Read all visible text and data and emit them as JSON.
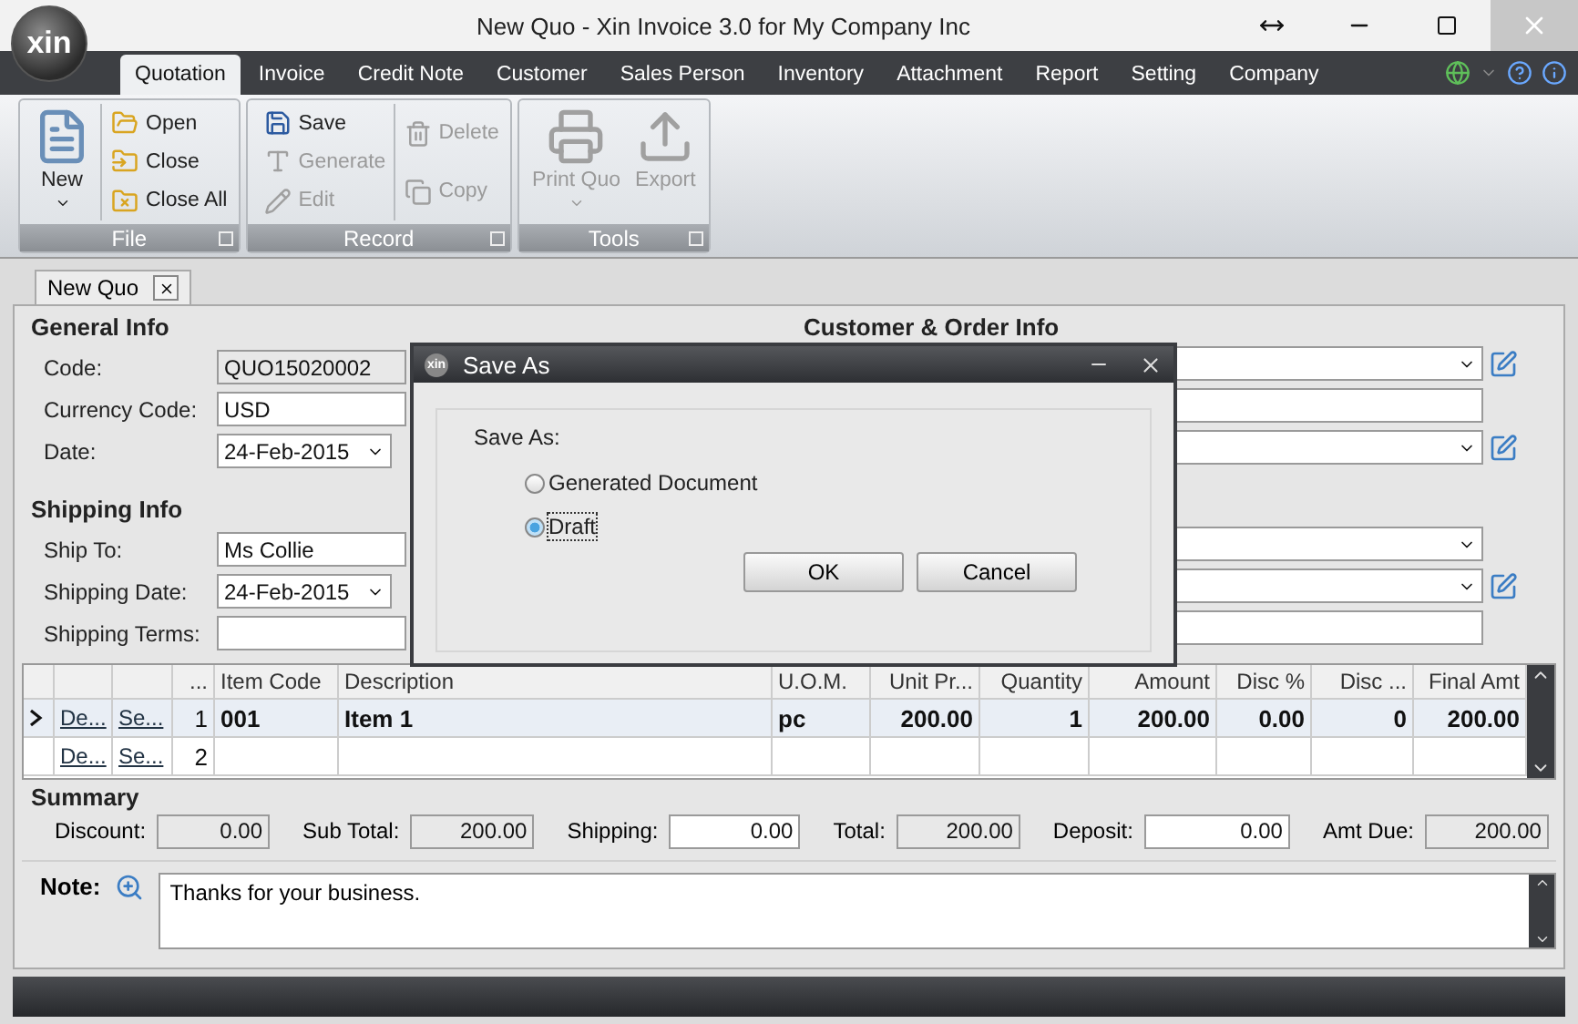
{
  "window": {
    "logo": "xin",
    "title": "New Quo - Xin Invoice 3.0 for My Company Inc"
  },
  "ribbon_tabs": [
    {
      "label": "Quotation",
      "selected": true
    },
    {
      "label": "Invoice",
      "selected": false
    },
    {
      "label": "Credit Note",
      "selected": false
    },
    {
      "label": "Customer",
      "selected": false
    },
    {
      "label": "Sales Person",
      "selected": false
    },
    {
      "label": "Inventory",
      "selected": false
    },
    {
      "label": "Attachment",
      "selected": false
    },
    {
      "label": "Report",
      "selected": false
    },
    {
      "label": "Setting",
      "selected": false
    },
    {
      "label": "Company",
      "selected": false
    }
  ],
  "ribbon_groups": [
    {
      "label": "File",
      "large": [
        {
          "label": "New",
          "disabled": false,
          "dropdown": true
        }
      ],
      "columns": [
        [
          {
            "label": "Open",
            "disabled": false
          },
          {
            "label": "Close",
            "disabled": false
          },
          {
            "label": "Close All",
            "disabled": false
          }
        ]
      ]
    },
    {
      "label": "Record",
      "columns": [
        [
          {
            "label": "Save",
            "disabled": false
          },
          {
            "label": "Generate",
            "disabled": true
          },
          {
            "label": "Edit",
            "disabled": true
          }
        ],
        [
          {
            "label": "Delete",
            "disabled": true
          },
          {
            "label": "Copy",
            "disabled": true
          }
        ]
      ]
    },
    {
      "label": "Tools",
      "large": [
        {
          "label": "Print Quo",
          "disabled": true,
          "dropdown": true
        },
        {
          "label": "Export",
          "disabled": true,
          "dropdown": false
        }
      ]
    }
  ],
  "document_tabs": [
    {
      "label": "New Quo",
      "selected": true
    }
  ],
  "general_info": {
    "title": "General Info",
    "fields": [
      {
        "label": "Code:",
        "value": "QUO15020002",
        "kind": "readonly"
      },
      {
        "label": "Currency Code:",
        "value": "USD",
        "kind": "text"
      },
      {
        "label": "Date:",
        "value": "24-Feb-2015",
        "kind": "date"
      }
    ]
  },
  "shipping_info": {
    "title": "Shipping Info",
    "fields": [
      {
        "label": "Ship To:",
        "value": "Ms Collie",
        "kind": "text"
      },
      {
        "label": "Shipping Date:",
        "value": "24-Feb-2015",
        "kind": "date"
      },
      {
        "label": "Shipping Terms:",
        "kind": "text"
      }
    ]
  },
  "customer_order_info": {
    "title": "Customer & Order Info",
    "fields": [
      {
        "kind": "combo",
        "editable": true
      },
      {
        "kind": "text",
        "editable": false
      },
      {
        "kind": "combo",
        "editable": true
      }
    ]
  },
  "shipping_extra": {
    "fields": [
      {
        "kind": "combo",
        "editable": false
      },
      {
        "kind": "combo",
        "editable": true
      },
      {
        "kind": "text",
        "editable": false
      }
    ]
  },
  "table": {
    "columns": [
      "",
      "",
      "",
      "...",
      "Item Code",
      "Description",
      "U.O.M.",
      "Unit Pr...",
      "Quantity",
      "Amount",
      "Disc %",
      "Disc ...",
      "Final Amt"
    ],
    "rows": [
      {
        "selected": true,
        "cells": [
          "",
          "De...",
          "Se...",
          "1",
          "001",
          "Item 1",
          "pc",
          "200.00",
          "1",
          "200.00",
          "0.00",
          "0",
          "200.00"
        ]
      },
      {
        "selected": false,
        "cells": [
          "",
          "De...",
          "Se...",
          "2",
          "",
          "",
          "",
          "",
          "",
          "",
          "",
          "",
          ""
        ]
      }
    ]
  },
  "summary": {
    "title": "Summary",
    "fields": [
      {
        "label": "Discount:",
        "value": "0.00",
        "editable": false
      },
      {
        "label": "Sub Total:",
        "value": "200.00",
        "editable": false
      },
      {
        "label": "Shipping:",
        "value": "0.00",
        "editable": true
      },
      {
        "label": "Total:",
        "value": "200.00",
        "editable": false
      },
      {
        "label": "Deposit:",
        "value": "0.00",
        "editable": true
      },
      {
        "label": "Amt Due:",
        "value": "200.00",
        "editable": false
      }
    ]
  },
  "note": {
    "label": "Note:",
    "value": "Thanks for your business."
  },
  "dialog": {
    "icon_text": "xin",
    "title": "Save As",
    "prompt": "Save As:",
    "options": [
      {
        "label": "Generated Document",
        "selected": false
      },
      {
        "label": "Draft",
        "selected": true
      }
    ],
    "buttons": [
      "OK",
      "Cancel"
    ]
  }
}
